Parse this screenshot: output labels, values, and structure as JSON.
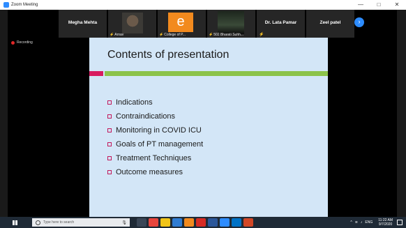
{
  "window": {
    "title": "Zoom Meeting",
    "controls": [
      "—",
      "□",
      "✕"
    ]
  },
  "gallery": {
    "participants": [
      {
        "name": "Megha Mehta"
      },
      {
        "name": "Arnav",
        "caption": "Arnav"
      },
      {
        "name": "College of P...",
        "caption": "College of P...",
        "logo_letter": "e"
      },
      {
        "name": "502 Bharati Suhh...",
        "caption": "502 Bharati Suhh..."
      },
      {
        "name": "Dr. Lata Pamar"
      },
      {
        "name": "Zeel patel"
      }
    ],
    "next_label": "›"
  },
  "recording": {
    "label": "Recording"
  },
  "slide": {
    "title": "Contents of presentation",
    "bullets": [
      "Indications",
      "Contraindications",
      "Monitoring in COVID ICU",
      "Goals of PT management",
      "Treatment Techniques",
      "Outcome measures"
    ],
    "accent_pink": "#d81b60",
    "accent_green": "#8bc34a"
  },
  "taskbar": {
    "search_placeholder": "Type here to search",
    "pinned_icons": [
      "task-view-icon",
      "chrome-icon",
      "file-explorer-icon",
      "edge-icon",
      "vlc-icon",
      "acrobat-icon",
      "word-icon",
      "zoom-icon",
      "outlook-icon",
      "powerpoint-icon"
    ],
    "language": "ENG",
    "time": "11:22 AM",
    "date": "9/7/2020"
  }
}
